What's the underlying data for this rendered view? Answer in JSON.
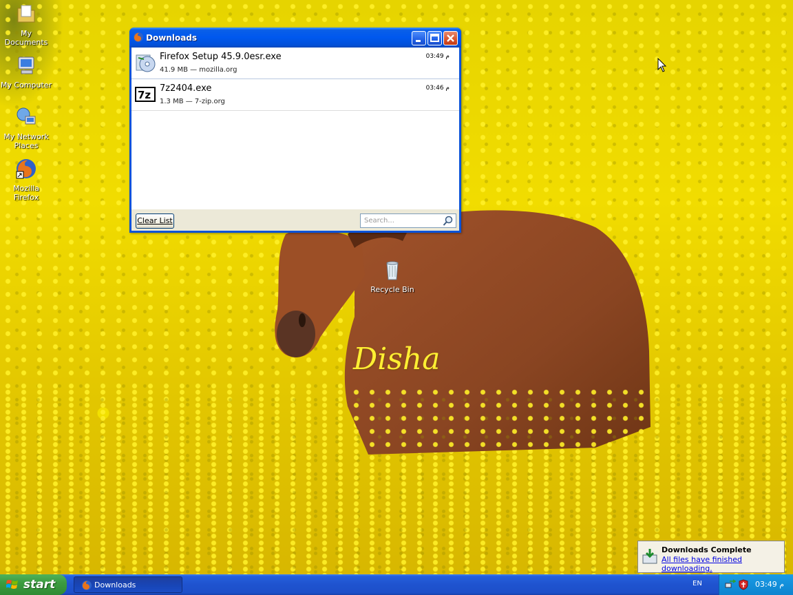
{
  "desktop": {
    "watermark": "Disha",
    "icons": [
      {
        "label": "My Documents",
        "icon": "folder-documents-icon"
      },
      {
        "label": "My Computer",
        "icon": "computer-icon"
      },
      {
        "label": "My Network Places",
        "icon": "network-icon"
      },
      {
        "label": "Mozilla Firefox",
        "icon": "firefox-icon"
      },
      {
        "label": "Recycle Bin",
        "icon": "recycle-bin-icon"
      }
    ]
  },
  "downloads_window": {
    "title": "Downloads",
    "items": [
      {
        "name": "Firefox Setup 45.9.0esr.exe",
        "meta": "41.9 MB — mozilla.org",
        "time": "03:49 م",
        "icon": "installer-icon"
      },
      {
        "name": "7z2404.exe",
        "meta": "1.3 MB — 7-zip.org",
        "time": "03:46 م",
        "icon": "7zip-icon"
      }
    ],
    "clear_button": "Clear List",
    "search_placeholder": "Search..."
  },
  "notification": {
    "title": "Downloads Complete",
    "message": "All files have finished downloading."
  },
  "taskbar": {
    "start_label": "start",
    "task_label": "Downloads",
    "language": "EN",
    "clock": "03:49 م"
  },
  "colors": {
    "titlebar_blue": "#0058ee",
    "taskbar_blue": "#245edb",
    "start_green": "#3c9c3f",
    "tray_blue": "#138fda"
  }
}
